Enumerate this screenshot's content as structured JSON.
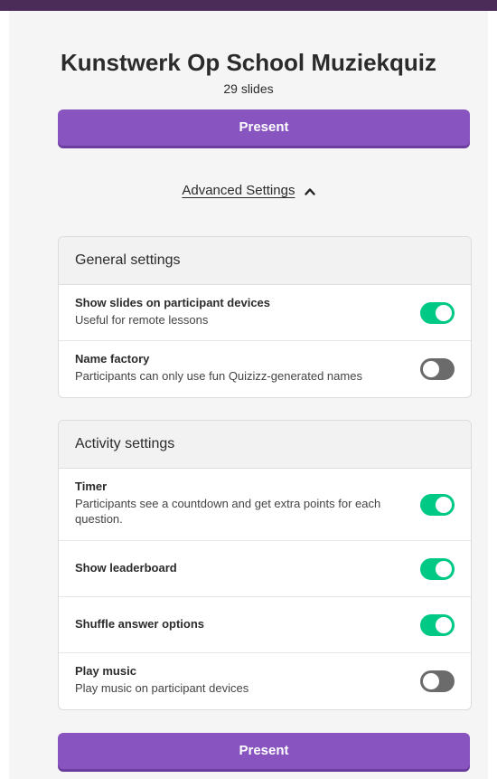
{
  "colors": {
    "accent_purple": "#8854c0",
    "toggle_on": "#00c985",
    "toggle_off": "#6b6b6b"
  },
  "quiz": {
    "title": "Kunstwerk Op School Muziekquiz",
    "slide_count": "29 slides"
  },
  "present_top_label": "Present",
  "present_bottom_label": "Present",
  "advanced": {
    "label": "Advanced Settings",
    "icon": "chevron-up-icon"
  },
  "general": {
    "header": "General settings",
    "settings": [
      {
        "title": "Show slides on participant devices",
        "description": "Useful for remote lessons",
        "enabled": true
      },
      {
        "title": "Name factory",
        "description": "Participants can only use fun Quizizz-generated names",
        "enabled": false
      }
    ]
  },
  "activity": {
    "header": "Activity settings",
    "settings": [
      {
        "title": "Timer",
        "description": "Participants see a countdown and get extra points for each question.",
        "enabled": true
      },
      {
        "title": "Show leaderboard",
        "description": "",
        "enabled": true
      },
      {
        "title": "Shuffle answer options",
        "description": "",
        "enabled": true
      },
      {
        "title": "Play music",
        "description": "Play music on participant devices",
        "enabled": false
      }
    ]
  }
}
